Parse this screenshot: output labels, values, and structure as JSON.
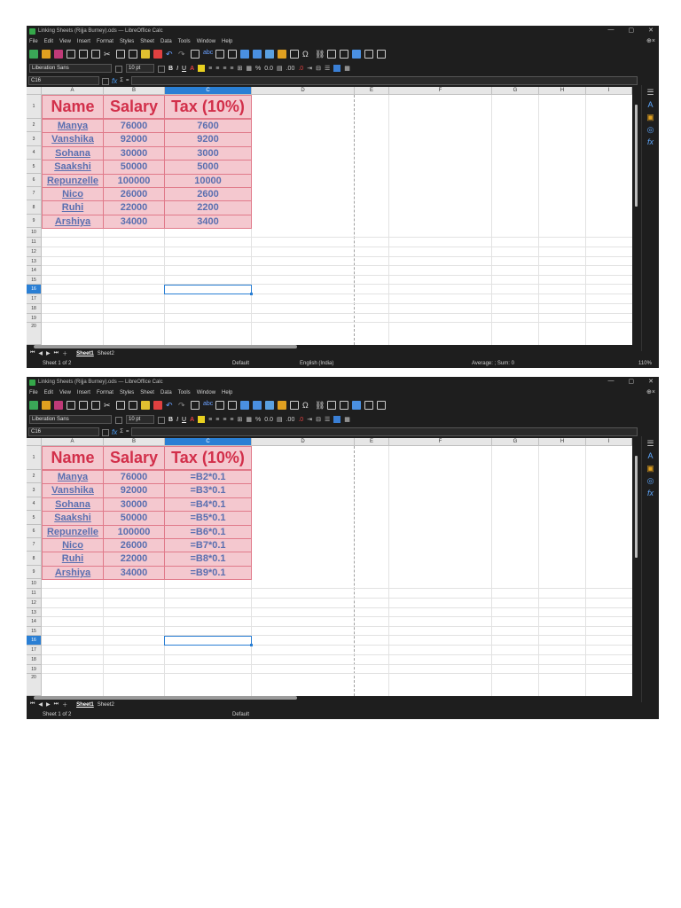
{
  "window": {
    "title": "Linking Sheets (Rijja Burney).ods — LibreOffice Calc",
    "controls": [
      "—",
      "▢",
      "✕"
    ]
  },
  "menu": [
    "File",
    "Edit",
    "View",
    "Insert",
    "Format",
    "Styles",
    "Sheet",
    "Data",
    "Tools",
    "Window",
    "Help"
  ],
  "format_bar": {
    "font_name": "Liberation Sans",
    "font_size": "10 pt",
    "bold": "B",
    "italic": "I",
    "underline": "U",
    "percent": "%",
    "decimal": "0.0"
  },
  "formula_bar": {
    "name_box": "C16",
    "fx": "fx",
    "sigma": "Σ",
    "equals": "="
  },
  "columns": [
    "A",
    "B",
    "C",
    "D",
    "E",
    "F",
    "G",
    "H",
    "I"
  ],
  "active_column": "C",
  "rows": [
    "1",
    "2",
    "3",
    "4",
    "5",
    "6",
    "7",
    "8",
    "9",
    "10",
    "11",
    "12",
    "13",
    "14",
    "15",
    "16",
    "17",
    "18",
    "19",
    "20"
  ],
  "active_row": "16",
  "headers": [
    "Name",
    "Salary",
    "Tax (10%)"
  ],
  "names": [
    "Manya",
    "Vanshika",
    "Sohana",
    "Saakshi",
    "Repunzelle",
    "Nico",
    "Ruhi",
    "Arshiya"
  ],
  "salaries": [
    "76000",
    "92000",
    "30000",
    "50000",
    "100000",
    "26000",
    "22000",
    "34000"
  ],
  "tax_values": [
    "7600",
    "9200",
    "3000",
    "5000",
    "10000",
    "2600",
    "2200",
    "3400"
  ],
  "tax_formulas": [
    "=B2*0.1",
    "=B3*0.1",
    "=B4*0.1",
    "=B5*0.1",
    "=B6*0.1",
    "=B7*0.1",
    "=B8*0.1",
    "=B9*0.1"
  ],
  "tabs": {
    "sheet1": "Sheet1",
    "sheet2": "Sheet2"
  },
  "status_top": {
    "sheet": "Sheet 1 of 2",
    "style": "Default",
    "language": "English (India)",
    "sum": "Average: ; Sum: 0",
    "zoom": "110%"
  },
  "status_bottom": {
    "sheet": "Sheet 1 of 2",
    "style": "Default"
  },
  "colors": {
    "header_text": "#d22f4a",
    "cell_fill": "#f4c8cf",
    "data_text": "#5a6fb0",
    "selection": "#2a7fd4"
  }
}
